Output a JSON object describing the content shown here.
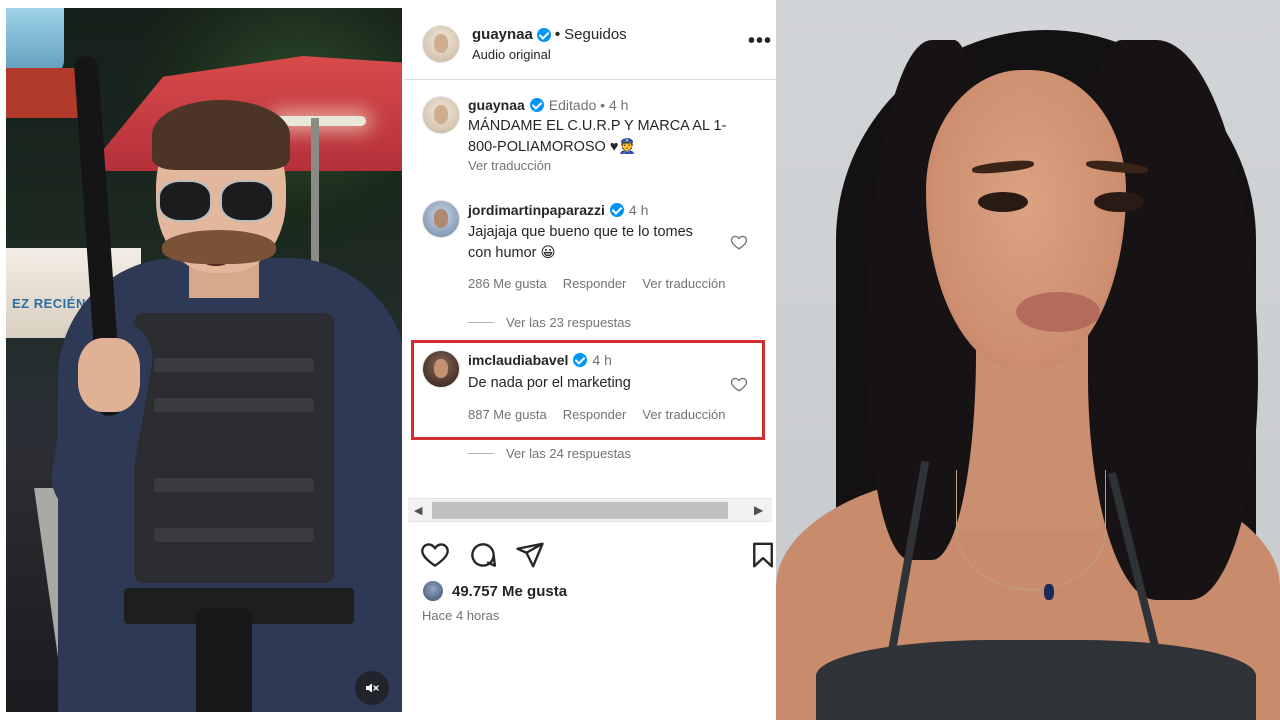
{
  "video": {
    "stand_sign_text": "EZ RECIÉN PE"
  },
  "header": {
    "username": "guaynaa",
    "separator": "•",
    "follow_status": "Seguidos",
    "subtitle": "Audio original",
    "more_label": "•••"
  },
  "caption": {
    "username": "guaynaa",
    "meta": "Editado  •  4 h",
    "text": "MÁNDAME EL C.U.R.P Y MARCA AL 1-800-POLIAMOROSO ♥👮",
    "translate": "Ver traducción"
  },
  "comments": [
    {
      "username": "jordimartinpaparazzi",
      "time": "4 h",
      "text": "Jajajaja que bueno que te lo tomes con humor 😀",
      "likes": "286 Me gusta",
      "reply": "Responder",
      "translate": "Ver traducción",
      "replies": "Ver las 23 respuestas"
    },
    {
      "username": "imclaudiabavel",
      "time": "4 h",
      "text": "De nada por el marketing",
      "likes": "887 Me gusta",
      "reply": "Responder",
      "translate": "Ver traducción",
      "replies": "Ver las 24 respuestas"
    }
  ],
  "scrollbar": {
    "left_arrow": "◀",
    "right_arrow": "▶"
  },
  "post": {
    "likes": "49.757 Me gusta",
    "time_ago": "Hace 4 horas"
  },
  "colors": {
    "verified": "#0095f6",
    "highlight": "#d32f2f",
    "text_primary": "#262626",
    "text_secondary": "#737373"
  },
  "icons": [
    "heart-icon",
    "comment-icon",
    "share-icon",
    "bookmark-icon",
    "mute-icon",
    "verified-icon",
    "more-icon"
  ]
}
